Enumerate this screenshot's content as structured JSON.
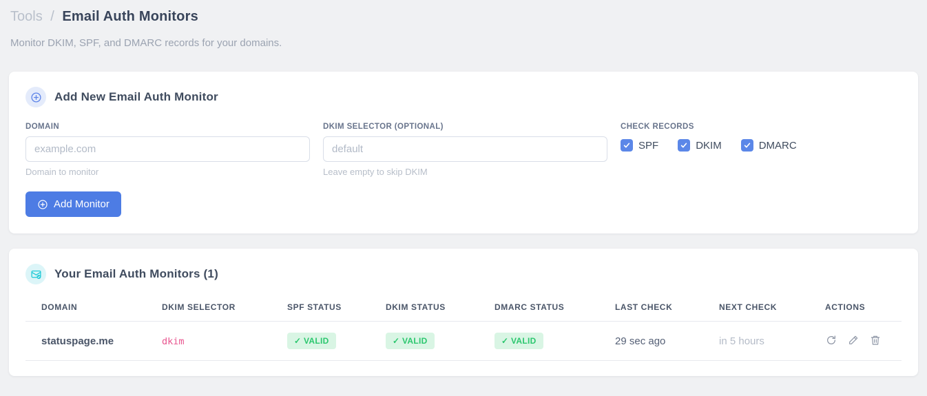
{
  "page": {
    "breadcrumb": {
      "section": "Tools",
      "separator": "/",
      "current": "Email Auth Monitors"
    },
    "subtitle": "Monitor DKIM, SPF, and DMARC records for your domains."
  },
  "add_monitor_card": {
    "icon": "plus-circle-icon",
    "title": "Add New Email Auth Monitor",
    "fields": {
      "domain": {
        "label": "DOMAIN",
        "placeholder": "example.com",
        "value": "",
        "helper": "Domain to monitor"
      },
      "dkim_selector": {
        "label": "DKIM SELECTOR (OPTIONAL)",
        "placeholder": "default",
        "value": "",
        "helper": "Leave empty to skip DKIM"
      }
    },
    "check_records": {
      "label": "CHECK RECORDS",
      "options": [
        {
          "label": "SPF",
          "checked": true
        },
        {
          "label": "DKIM",
          "checked": true
        },
        {
          "label": "DMARC",
          "checked": true
        }
      ]
    },
    "submit_label": "Add Monitor"
  },
  "monitors_card": {
    "icon": "email-check-icon",
    "title": "Your Email Auth Monitors (1)",
    "count": 1,
    "table": {
      "columns": [
        "DOMAIN",
        "DKIM SELECTOR",
        "SPF STATUS",
        "DKIM STATUS",
        "DMARC STATUS",
        "LAST CHECK",
        "NEXT CHECK",
        "ACTIONS"
      ],
      "rows": [
        {
          "domain": "statuspage.me",
          "dkim_selector": "dkim",
          "spf_status": "✓ VALID",
          "dkim_status": "✓ VALID",
          "dmarc_status": "✓ VALID",
          "last_check": "29 sec ago",
          "next_check": "in 5 hours",
          "actions": [
            "refresh-icon",
            "edit-icon",
            "delete-icon"
          ]
        }
      ]
    }
  },
  "colors": {
    "accent_blue": "#4d7ce4",
    "checkbox_blue": "#5b87e8",
    "valid_badge_bg": "#d9f5e4",
    "valid_badge_text": "#2bc76e",
    "code_pink": "#e8548e",
    "cyan_icon": "#1fc9d6",
    "page_bg": "#f0f1f3"
  }
}
